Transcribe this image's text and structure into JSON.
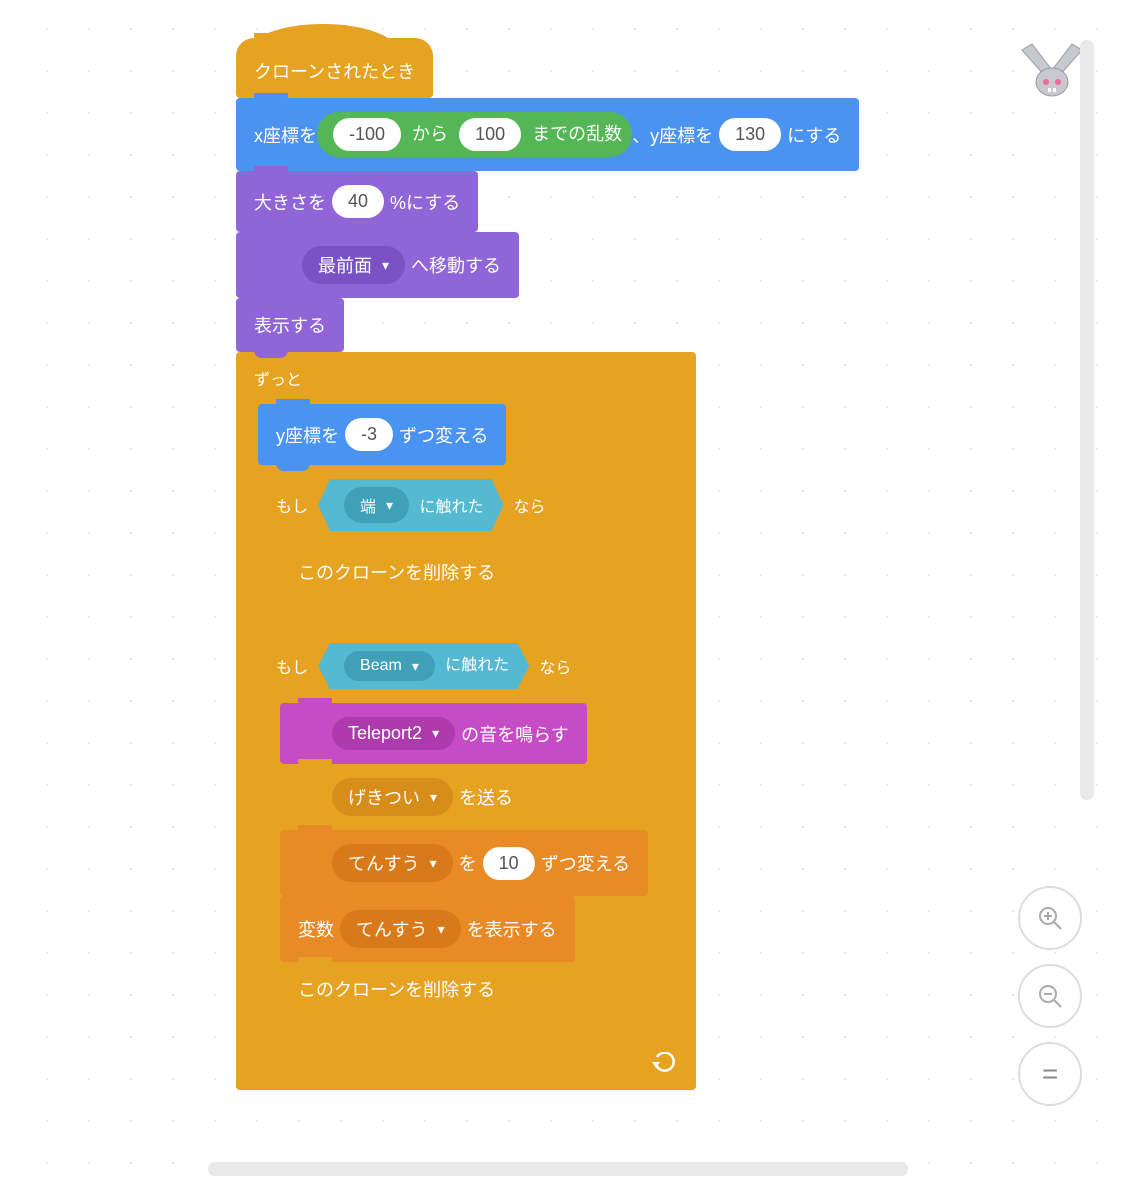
{
  "hat": {
    "label": "クローンされたとき"
  },
  "goto": {
    "x_prefix": "x座標を",
    "rand_min": "-100",
    "rand_mid": "から",
    "rand_max": "100",
    "rand_suffix": "までの乱数",
    "sep": "、",
    "y_prefix": "y座標を",
    "y_val": "130",
    "suffix": "にする"
  },
  "size": {
    "prefix": "大きさを",
    "val": "40",
    "suffix": "%にする"
  },
  "layer": {
    "dd": "最前面",
    "suffix": "へ移動する"
  },
  "show": {
    "label": "表示する"
  },
  "forever": {
    "label": "ずっと"
  },
  "changeY": {
    "prefix": "y座標を",
    "val": "-3",
    "suffix": "ずつ変える"
  },
  "if1": {
    "prefix": "もし",
    "touch_dd": "端",
    "touch_suffix": "に触れた",
    "suffix": "なら",
    "body": "このクローンを削除する"
  },
  "if2": {
    "prefix": "もし",
    "touch_dd": "Beam",
    "touch_suffix": "に触れた",
    "suffix": "なら",
    "sound_dd": "Teleport2",
    "sound_suffix": "の音を鳴らす",
    "broadcast_dd": "げきつい",
    "broadcast_suffix": "を送る",
    "chg_dd": "てんすう",
    "chg_mid": "を",
    "chg_val": "10",
    "chg_suffix": "ずつ変える",
    "showvar_prefix": "変数",
    "showvar_dd": "てんすう",
    "showvar_suffix": "を表示する",
    "del": "このクローンを削除する"
  },
  "zoom": {
    "in": "+",
    "out": "−",
    "reset": "="
  }
}
